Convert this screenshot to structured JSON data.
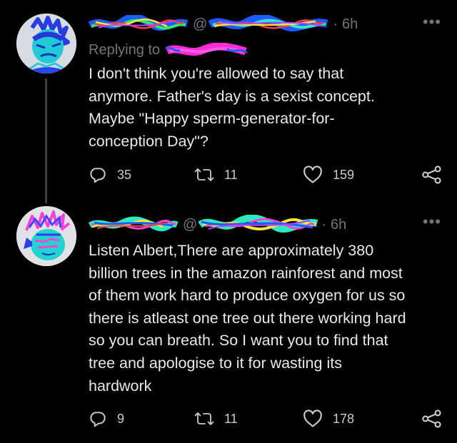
{
  "tweets": [
    {
      "time": "6h",
      "replying_prefix": "Replying to",
      "text": "I don't think you're allowed to say that\nanymore.  Father's day is a sexist concept.\nMaybe \"Happy sperm-generator-for-\nconception Day\"?",
      "stats": {
        "replies": "35",
        "retweets": "11",
        "likes": "159"
      }
    },
    {
      "time": "6h",
      "text": "Listen Albert,There are approximately 380\nbillion trees in the amazon rainforest and most\nof them work hard to produce oxygen for us so\nthere is atleast one tree out there working hard\nso you can breath. So I want you to find that\ntree and apologise to it for wasting its\nhardwork",
      "stats": {
        "replies": "9",
        "retweets": "11",
        "likes": "178"
      }
    }
  ],
  "header": {
    "at": "@",
    "dot": "·"
  },
  "more_glyph": "•••",
  "icons": {
    "reply": "reply-icon",
    "retweet": "retweet-icon",
    "like": "heart-icon",
    "share": "share-icon",
    "more": "more-icon"
  },
  "colors": {
    "background": "#000000",
    "text": "#e7e9ea",
    "muted": "#71767b",
    "thread_line": "#3b4046"
  }
}
